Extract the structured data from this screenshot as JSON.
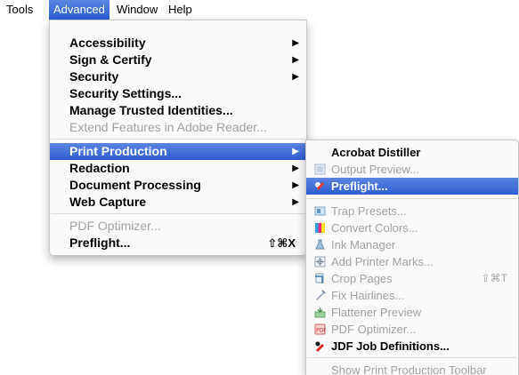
{
  "menubar": {
    "items": [
      "Tools",
      "Advanced",
      "Window",
      "Help"
    ]
  },
  "advanced_menu": {
    "items": [
      {
        "label": "Accessibility",
        "submenu": true
      },
      {
        "label": "Sign & Certify",
        "submenu": true
      },
      {
        "label": "Security",
        "submenu": true
      },
      {
        "label": "Security Settings..."
      },
      {
        "label": "Manage Trusted Identities..."
      },
      {
        "label": "Extend Features in Adobe Reader...",
        "disabled": true
      },
      {
        "label": "Print Production",
        "submenu": true,
        "highlighted": true
      },
      {
        "label": "Redaction",
        "submenu": true
      },
      {
        "label": "Document Processing",
        "submenu": true
      },
      {
        "label": "Web Capture",
        "submenu": true
      },
      {
        "label": "PDF Optimizer...",
        "disabled": true
      },
      {
        "label": "Preflight...",
        "shortcut": "⇧⌘X"
      }
    ],
    "arrow_glyph": "▶"
  },
  "print_production_submenu": {
    "items": [
      {
        "label": "Acrobat Distiller",
        "icon": null
      },
      {
        "label": "Output Preview...",
        "disabled": true,
        "icon": "output-preview-icon"
      },
      {
        "label": "Preflight...",
        "highlighted": true,
        "icon": "preflight-icon"
      },
      {
        "label": "Trap Presets...",
        "disabled": true,
        "icon": "trap-presets-icon"
      },
      {
        "label": "Convert Colors...",
        "disabled": true,
        "icon": "convert-colors-icon"
      },
      {
        "label": "Ink Manager",
        "disabled": true,
        "icon": "ink-manager-icon"
      },
      {
        "label": "Add Printer Marks...",
        "disabled": true,
        "icon": "printer-marks-icon"
      },
      {
        "label": "Crop Pages",
        "disabled": true,
        "shortcut": "⇧⌘T",
        "icon": "crop-pages-icon"
      },
      {
        "label": "Fix Hairlines...",
        "disabled": true,
        "icon": "fix-hairlines-icon"
      },
      {
        "label": "Flattener Preview",
        "disabled": true,
        "icon": "flattener-preview-icon"
      },
      {
        "label": "PDF Optimizer...",
        "disabled": true,
        "icon": "pdf-optimizer-icon"
      },
      {
        "label": "JDF Job Definitions...",
        "icon": "jdf-icon"
      },
      {
        "label": "Show Print Production Toolbar",
        "disabled": true
      }
    ]
  },
  "colors": {
    "highlight": "#2d5dd3",
    "disabled_text": "#a3a3a3"
  }
}
